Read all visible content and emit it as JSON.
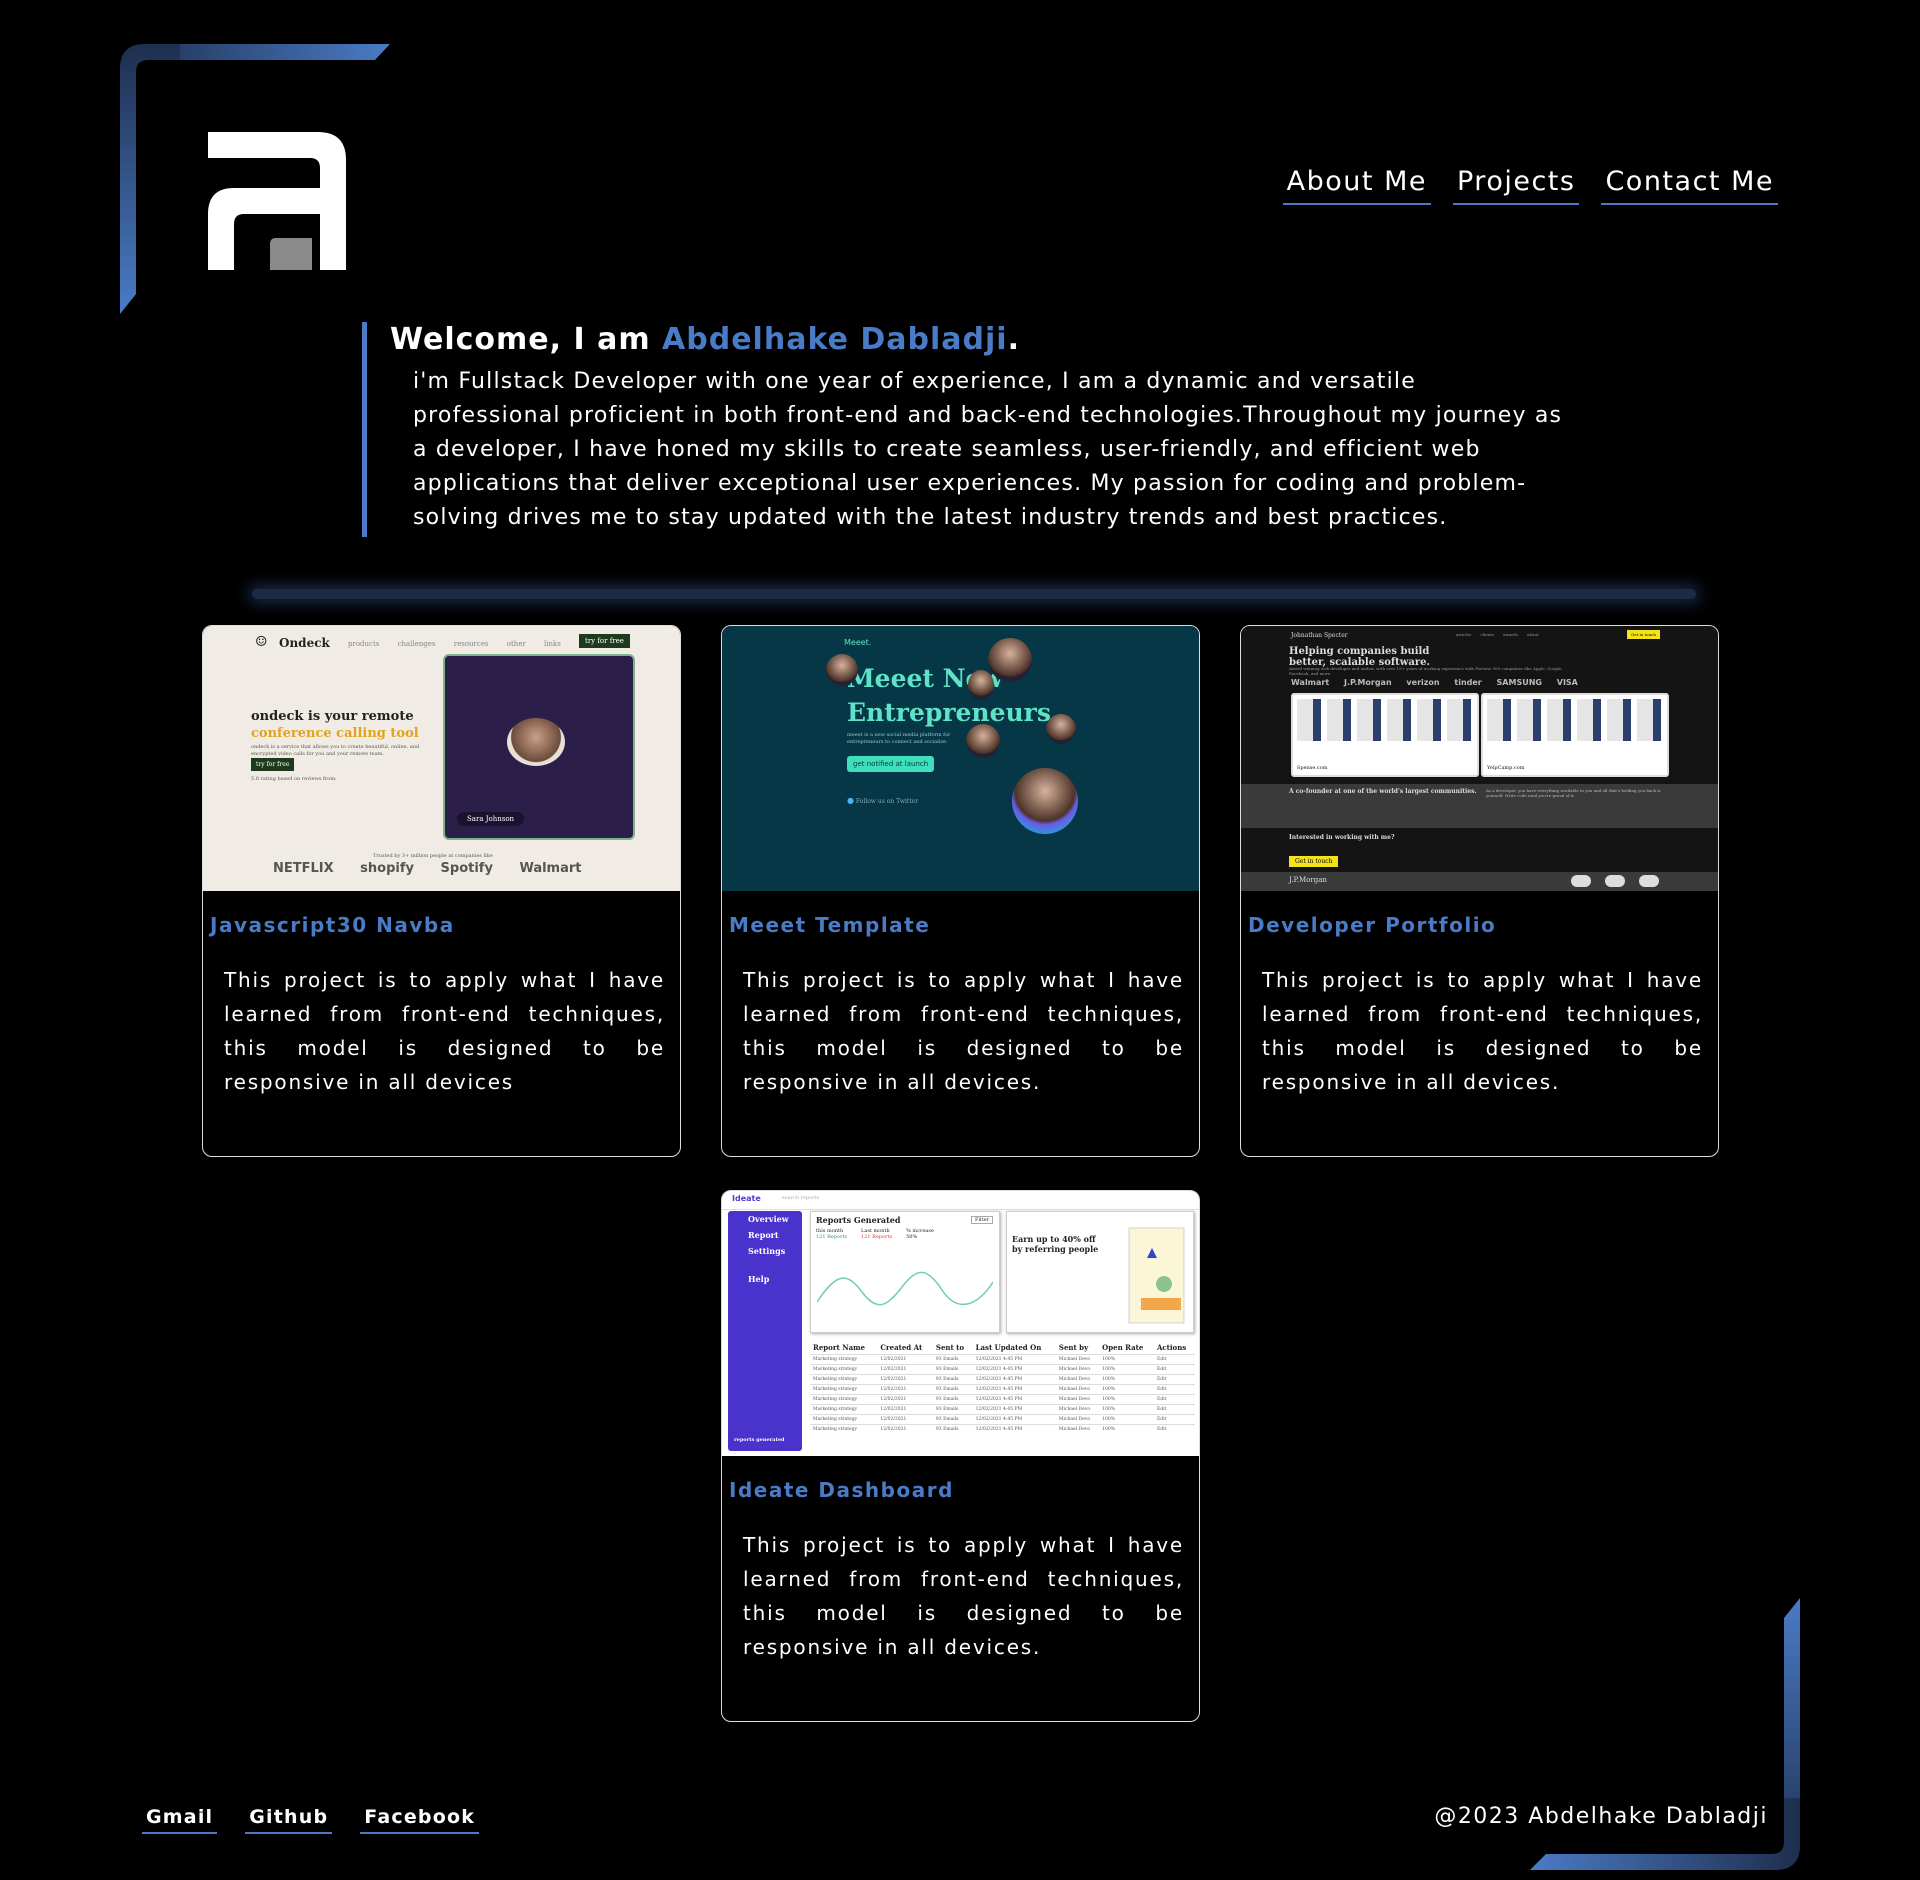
{
  "header": {
    "logo": "A",
    "nav": [
      "About Me",
      "Projects",
      "Contact Me"
    ]
  },
  "intro": {
    "welcome_prefix": "Welcome, I am ",
    "name": "Abdelhake Dabladji",
    "welcome_suffix": ".",
    "bio": "i'm Fullstack Developer with one year of experience, I am a dynamic and versatile professional proficient in both front-end and back-end technologies.Throughout my journey as a developer, I have honed my skills to create seamless, user-friendly, and efficient web applications that deliver exceptional user experiences. My passion for coding and problem-solving drives me to stay updated with the latest industry trends and best practices."
  },
  "projects": [
    {
      "title": "Javascript30 Navba",
      "description": "This project is to apply what I have learned from front-end techniques, this model is designed to be responsive in all devices",
      "preview": {
        "brand": "Ondeck",
        "menu": "products challenges resources other links sign in",
        "cta": "try for free",
        "heading": "ondeck is your remote",
        "heading_accent": "conference calling tool",
        "subtext": "ondeck is a service that allows you to create beautiful, online, and encrypted video calls for you and your remote team.",
        "button": "try for free",
        "rating": "5.0 rating based on reviews from:",
        "caller": "Sara Johnson",
        "trusted": "Trusted by 3+ million people at companies like",
        "brands": "NETFLIX shopify Spotify Walmart"
      }
    },
    {
      "title": "Meeet Template",
      "description": "This project is to apply what I have learned from front-end techniques, this model is designed to be responsive in all devices.",
      "preview": {
        "brand": "Meeet.",
        "heading_1": "Meeet New",
        "heading_2": "Entrepreneurs",
        "subtext": "meeet is a new social media platform for entrepreneurs to connect and socialize.",
        "button": "get notified at launch",
        "twitter": "Follow us on Twitter"
      }
    },
    {
      "title": "Developer Portfolio",
      "description": "This project is to apply what I have learned from front-end techniques, this model is designed to be responsive in all devices.",
      "preview": {
        "name": "Johnathan Specter",
        "nav": "articles clients awards about",
        "cta": "Get in touch",
        "heading_1": "Helping companies build",
        "heading_2": "better, scalable software.",
        "subtext": "Award winning web developer and author, with over 15+ years of working experience with Fortune 500 companies like Apple, Google, Facebook, and more.",
        "brands": "Walmart J.P.Morgan verizon tinder SAMSUNG VISA",
        "shot_1": "Spense.com",
        "shot_2": "YelpCamp.com",
        "band_heading": "A co-founder at one of the world's largest communities.",
        "band_text": "As a developer, you have everything available to you and all that's holding you back is yourself. Write code until you're proud of it.",
        "question": "Interested in working with me?",
        "button": "Get in touch",
        "footer": "J.P.Morgan"
      }
    },
    {
      "title": "Ideate Dashboard",
      "description": "This project is to apply what I have learned from front-end techniques, this model is designed to be responsive in all devices.",
      "preview": {
        "brand": "Ideate",
        "search": "search reports",
        "menu": [
          "Overview",
          "Report",
          "Settings",
          "Help"
        ],
        "reports_generated": "reports generated",
        "panel_title": "Reports Generated",
        "filter": "Filter",
        "this_month": "this month",
        "last_month": "Last month",
        "increase": "% increase",
        "this_month_value": "121 Reports",
        "last_month_value": "121 Reports",
        "increase_value": "50%",
        "earn": "Earn up to 40% off by referring people",
        "columns": [
          "Report Name",
          "Created At",
          "Sent to",
          "Last Updated On",
          "Sent by",
          "Open Rate",
          "Actions"
        ],
        "row": [
          "Marketing strategy",
          "12/02/2021",
          "93 Emails",
          "12/02/2021 4:45 PM",
          "Michael Devo",
          "100%",
          "Edit"
        ]
      }
    }
  ],
  "footer": {
    "links": [
      "Gmail",
      "Github",
      "Facebook"
    ],
    "copyright": "@2023 Abdelhake Dabladji"
  },
  "colors": {
    "accent": "#4a7bc6",
    "background": "#000000",
    "text": "#ffffff"
  }
}
